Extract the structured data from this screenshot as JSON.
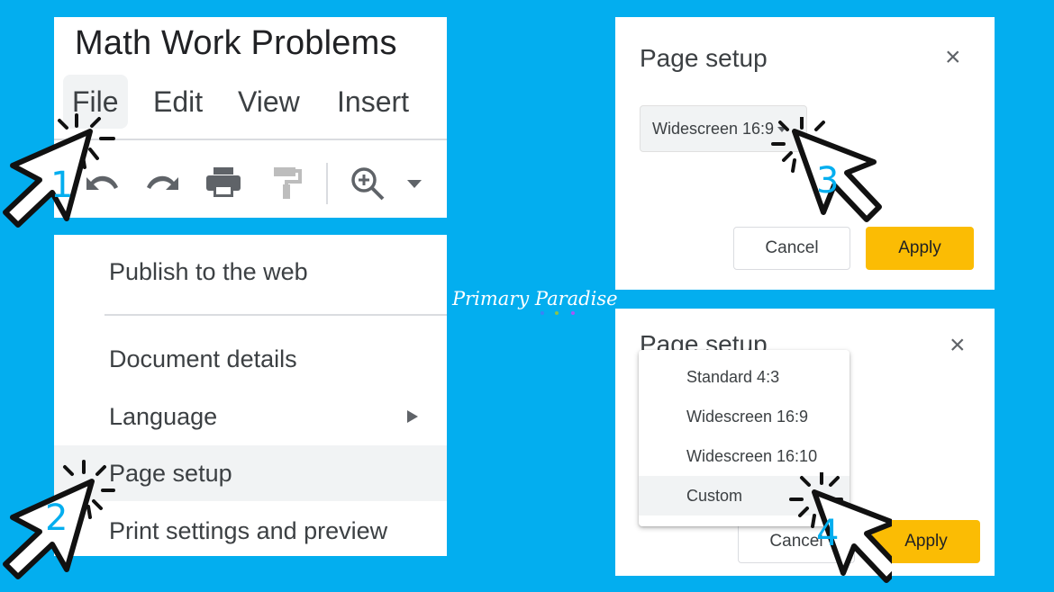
{
  "background_color": "#03aeef",
  "accent_color": "#fbbc04",
  "brand": {
    "watermark": "Primary Paradise",
    "dot_colors": [
      "#3b82f6",
      "#8bc34a",
      "#a855f7"
    ]
  },
  "step1": {
    "doc_title": "Math Work Problems",
    "menu": [
      {
        "label": "File",
        "active": true
      },
      {
        "label": "Edit",
        "active": false
      },
      {
        "label": "View",
        "active": false
      },
      {
        "label": "Insert",
        "active": false
      }
    ],
    "toolbar": [
      {
        "icon": "undo-icon"
      },
      {
        "icon": "redo-icon"
      },
      {
        "icon": "print-icon"
      },
      {
        "icon": "paint-format-icon"
      },
      {
        "icon": "zoom-icon"
      },
      {
        "icon": "dropdown-caret-icon"
      }
    ],
    "step_number": "1"
  },
  "step2": {
    "menu_items": [
      {
        "label": "Publish to the web",
        "highlighted": false
      },
      {
        "label": "Document details",
        "highlighted": false
      },
      {
        "label": "Language",
        "highlighted": false,
        "has_submenu": true
      },
      {
        "label": "Page setup",
        "highlighted": true
      },
      {
        "label": "Print settings and preview",
        "highlighted": false
      }
    ],
    "step_number": "2"
  },
  "step3": {
    "dialog_title": "Page setup",
    "close_icon": "×",
    "selected_size": "Widescreen 16:9",
    "cancel_label": "Cancel",
    "apply_label": "Apply",
    "step_number": "3"
  },
  "step4": {
    "dialog_title": "Page setup",
    "close_icon": "×",
    "options": [
      {
        "label": "Standard 4:3",
        "highlighted": false
      },
      {
        "label": "Widescreen 16:9",
        "highlighted": false
      },
      {
        "label": "Widescreen 16:10",
        "highlighted": false
      },
      {
        "label": "Custom",
        "highlighted": true
      }
    ],
    "cancel_label": "Cancel",
    "apply_label": "Apply",
    "step_number": "4"
  }
}
